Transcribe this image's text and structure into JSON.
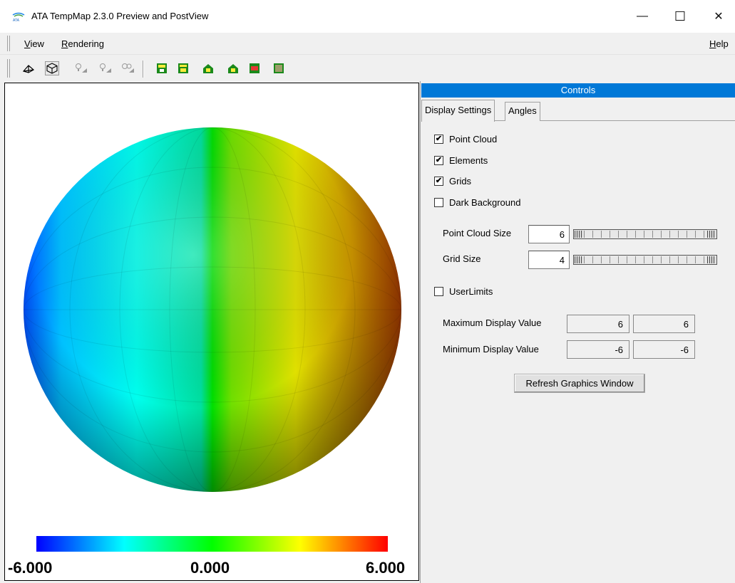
{
  "window": {
    "title": "ATA TempMap 2.3.0 Preview and PostView",
    "minimize_glyph": "—",
    "maximize_glyph": "☐",
    "close_glyph": "✕"
  },
  "menu": {
    "view_first": "V",
    "view_rest": "iew",
    "rendering_first": "R",
    "rendering_rest": "endering",
    "help_first": "H",
    "help_rest": "elp"
  },
  "toolbar": {
    "icons": [
      "wireframe-view-icon",
      "solid-view-icon",
      "light-1-icon",
      "light-2-icon",
      "light-3-icon",
      "view-front-icon",
      "view-back-icon",
      "view-left-icon",
      "view-right-icon",
      "view-top-icon",
      "view-bottom-icon"
    ]
  },
  "graphics": {
    "colorbar_min": "-6.000",
    "colorbar_mid": "0.000",
    "colorbar_max": "6.000",
    "colormap": [
      "#0000ff",
      "#00ffff",
      "#00ff00",
      "#ffff00",
      "#ff0000"
    ]
  },
  "controls": {
    "header": "Controls",
    "tabs": [
      "Display Settings",
      "Angles"
    ],
    "active_tab": "Display Settings",
    "checkboxes": [
      {
        "label": "Point Cloud",
        "checked": true
      },
      {
        "label": "Elements",
        "checked": true
      },
      {
        "label": "Grids",
        "checked": true
      },
      {
        "label": "Dark Background",
        "checked": false
      }
    ],
    "point_cloud_size_label": "Point Cloud Size",
    "point_cloud_size_value": "6",
    "grid_size_label": "Grid Size",
    "grid_size_value": "4",
    "user_limits_label": "UserLimits",
    "user_limits_checked": false,
    "max_label": "Maximum Display Value",
    "max_value_a": "6",
    "max_value_b": "6",
    "min_label": "Minimum Display Value",
    "min_value_a": "-6",
    "min_value_b": "-6",
    "refresh_label": "Refresh Graphics Window",
    "accent": "#0078d7"
  }
}
